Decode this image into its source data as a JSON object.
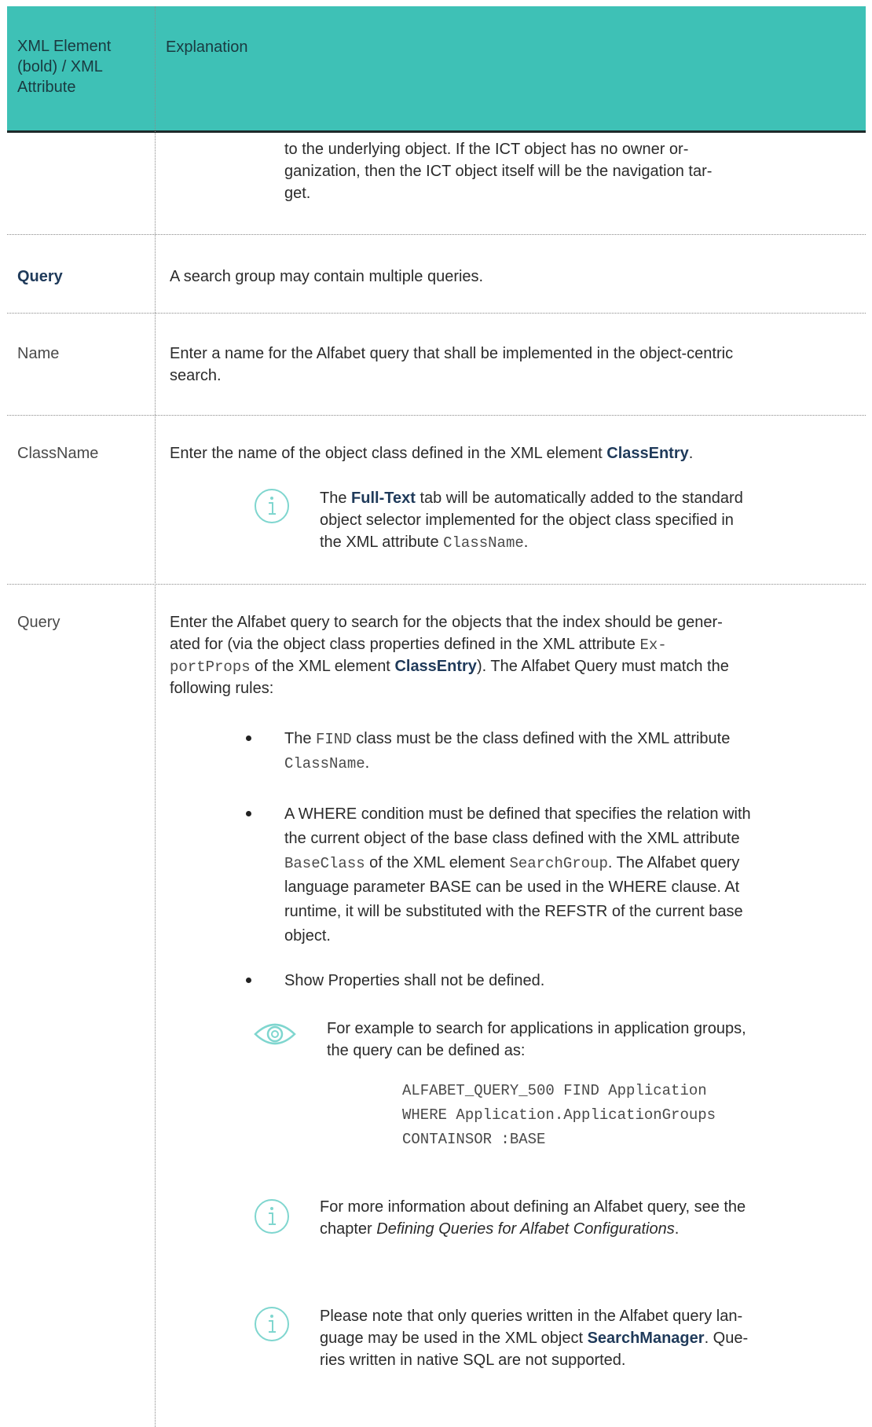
{
  "table": {
    "header": {
      "col1": "XML Element (bold) / XML Attribute",
      "col2": "Explanation"
    },
    "continuation": {
      "line1": "to the underlying object. If the ICT object has no owner or-",
      "line2": "ganization, then the ICT object itself will be the navigation tar-",
      "line3": "get."
    },
    "rows": [
      {
        "name": "Query",
        "explanation": "A search group may contain multiple queries."
      },
      {
        "name": "Name",
        "line1": "Enter a name for the Alfabet query that shall be implemented in the object-centric",
        "line2": "search."
      },
      {
        "name": "ClassName",
        "pre": "Enter the name of the object class defined in the XML element ",
        "bold": "ClassEntry",
        "post": ".",
        "note": {
          "l1_pre": "The ",
          "l1_bold": "Full-Text",
          "l1_post": " tab will be automatically added to the standard",
          "l2": "object selector implemented for the object class specified in",
          "l3_pre": "the XML attribute ",
          "l3_code": "ClassName",
          "l3_post": "."
        }
      },
      {
        "name": "Query",
        "p1": "Enter the Alfabet query to search for the objects that the index should be gener-",
        "p2_pre": "ated for (via the object class properties defined in the XML attribute ",
        "p2_code": "Ex-",
        "p3_code": "portProps",
        "p3_mid": " of the XML element ",
        "p3_bold": "ClassEntry",
        "p3_post": "). The Alfabet Query must match the",
        "p4": "following rules:",
        "b1_l1_pre": "The ",
        "b1_l1_code": "FIND",
        "b1_l1_post": " class must be the class defined with the XML attribute",
        "b1_l2_code": "ClassName",
        "b1_l2_post": ".",
        "b2_l1": "A WHERE condition must be defined that specifies the relation with",
        "b2_l2": "the current object of the base class defined with the XML attribute",
        "b2_l3_code": "BaseClass",
        "b2_l3_mid": " of the XML element ",
        "b2_l3_code2": "SearchGroup",
        "b2_l3_post": ". The Alfabet query",
        "b2_l4": "language parameter BASE can be used in the WHERE clause. At",
        "b2_l5": "runtime, it will be substituted with the REFSTR of the current base",
        "b2_l6": "object.",
        "b3": "Show Properties shall not be defined.",
        "example_l1": "For example to search for applications in application groups,",
        "example_l2": "the query can be defined as:",
        "code_l1": "ALFABET_QUERY_500 FIND Application",
        "code_l2": "WHERE Application.ApplicationGroups",
        "code_l3": "CONTAINSOR :BASE",
        "info1_l1": "For more information about defining an Alfabet query, see the",
        "info1_l2_pre": "chapter ",
        "info1_l2_italic": "Defining Queries for Alfabet Configurations",
        "info1_l2_post": ".",
        "info2_l1": "Please note that only queries written in the Alfabet query lan-",
        "info2_l2_pre": "guage may be used in the XML object ",
        "info2_l2_bold": "SearchManager",
        "info2_l2_post": ". Que-",
        "info2_l3": "ries written in native SQL are not supported."
      }
    ]
  },
  "colors": {
    "header_bg": "#3ec1b6",
    "icon_teal": "#7fd6cf"
  }
}
